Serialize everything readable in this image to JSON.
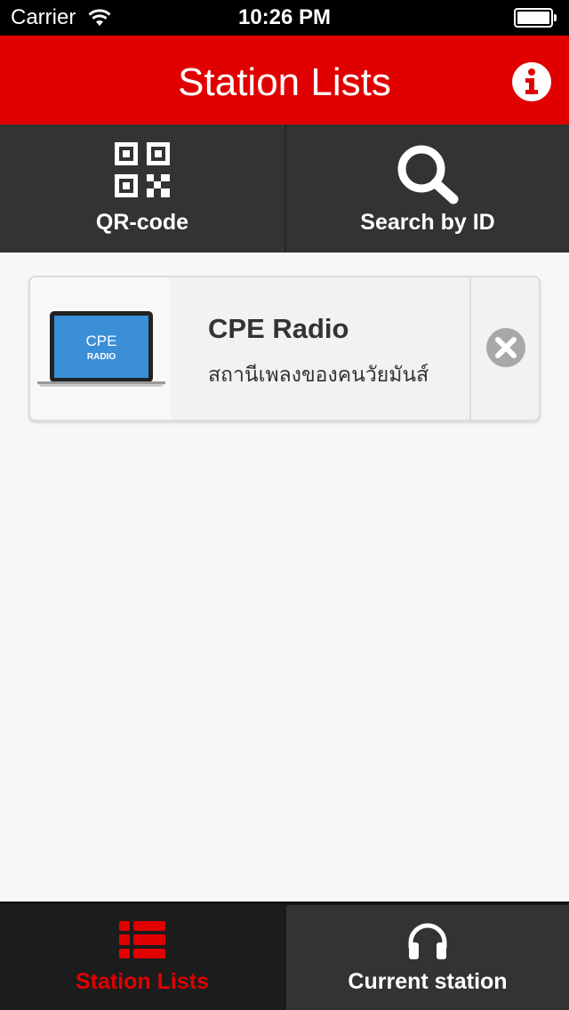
{
  "status_bar": {
    "carrier": "Carrier",
    "time": "10:26 PM",
    "battery_level": 1.0
  },
  "header": {
    "title": "Station Lists",
    "info_icon": "info-icon"
  },
  "actions": [
    {
      "label": "QR-code",
      "icon": "qr-code-icon"
    },
    {
      "label": "Search by ID",
      "icon": "search-icon"
    }
  ],
  "stations": [
    {
      "name": "CPE Radio",
      "description": "สถานีเพลงของคนวัยมันส์",
      "logo_text_1": "CPE",
      "logo_text_2": "RADIO",
      "remove_icon": "remove-icon"
    }
  ],
  "tab_bar": {
    "tabs": [
      {
        "label": "Station Lists",
        "icon": "list-icon",
        "active": true
      },
      {
        "label": "Current station",
        "icon": "headphones-icon",
        "active": false
      }
    ]
  },
  "colors": {
    "accent": "#e00000",
    "dark": "#333333",
    "background": "#f7f7f7",
    "logo_blue": "#3a8fd6"
  }
}
